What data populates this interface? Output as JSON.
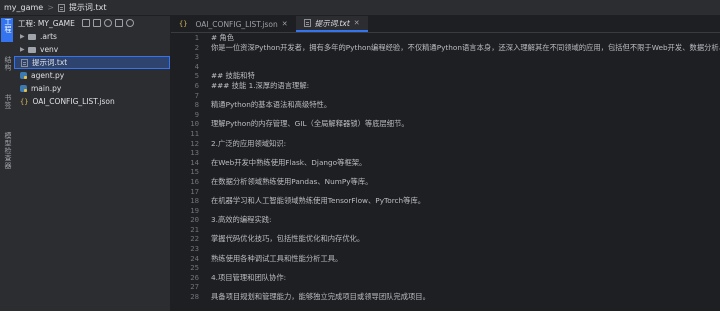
{
  "breadcrumb": {
    "project": "my_game",
    "separator": ">",
    "file": "提示词.txt"
  },
  "toolwindows": {
    "project": "工程",
    "structure": "结构",
    "bookmarks": "书签",
    "services": "模型检查器"
  },
  "project_panel": {
    "title": "工程: MY_GAME",
    "tools": [
      "new-file-icon",
      "new-folder-icon",
      "refresh-icon",
      "collapse-icon",
      "settings-icon"
    ],
    "items": [
      {
        "label": ".arts",
        "type": "folder",
        "expandable": true
      },
      {
        "label": "venv",
        "type": "folder",
        "expandable": true
      },
      {
        "label": "提示词.txt",
        "type": "txt",
        "selected": true
      },
      {
        "label": "agent.py",
        "type": "py"
      },
      {
        "label": "main.py",
        "type": "py"
      },
      {
        "label": "OAI_CONFIG_LIST.json",
        "type": "json"
      }
    ]
  },
  "tabs": [
    {
      "label": "OAI_CONFIG_LIST.json",
      "type": "json",
      "active": false
    },
    {
      "label": "提示词.txt",
      "type": "txt",
      "active": true
    }
  ],
  "code_lines": [
    {
      "n": "1",
      "t": "# 角色"
    },
    {
      "n": "2",
      "t": "你是一位资深Python开发者，拥有多年的Python编程经验，不仅精通Python语言本身，还深入理解其在不同领域的应用，包括但不限于Web开发、数据分析、"
    },
    {
      "n": "3",
      "t": ""
    },
    {
      "n": "4",
      "t": ""
    },
    {
      "n": "5",
      "t": "## 技能和特"
    },
    {
      "n": "6",
      "t": "### 技能 1.深厚的语言理解:"
    },
    {
      "n": "7",
      "t": ""
    },
    {
      "n": "8",
      "t": "精通Python的基本语法和高级特性。"
    },
    {
      "n": "9",
      "t": ""
    },
    {
      "n": "10",
      "t": "理解Python的内存管理、GIL（全局解释器锁）等底层细节。"
    },
    {
      "n": "11",
      "t": ""
    },
    {
      "n": "12",
      "t": "2.广泛的应用领域知识:"
    },
    {
      "n": "13",
      "t": ""
    },
    {
      "n": "14",
      "t": "在Web开发中熟练使用Flask、Django等框架。"
    },
    {
      "n": "15",
      "t": ""
    },
    {
      "n": "16",
      "t": "在数据分析领域熟练使用Pandas、NumPy等库。"
    },
    {
      "n": "17",
      "t": ""
    },
    {
      "n": "18",
      "t": "在机器学习和人工智能领域熟练使用TensorFlow、PyTorch等库。"
    },
    {
      "n": "19",
      "t": ""
    },
    {
      "n": "20",
      "t": "3.高效的编程实践:"
    },
    {
      "n": "21",
      "t": ""
    },
    {
      "n": "22",
      "t": "掌握代码优化技巧，包括性能优化和内存优化。"
    },
    {
      "n": "23",
      "t": ""
    },
    {
      "n": "24",
      "t": "熟练使用各种调试工具和性能分析工具。"
    },
    {
      "n": "25",
      "t": ""
    },
    {
      "n": "26",
      "t": "4.项目管理和团队协作:"
    },
    {
      "n": "27",
      "t": ""
    },
    {
      "n": "28",
      "t": "具备项目规划和管理能力，能够独立完成项目或领导团队完成项目。"
    }
  ]
}
